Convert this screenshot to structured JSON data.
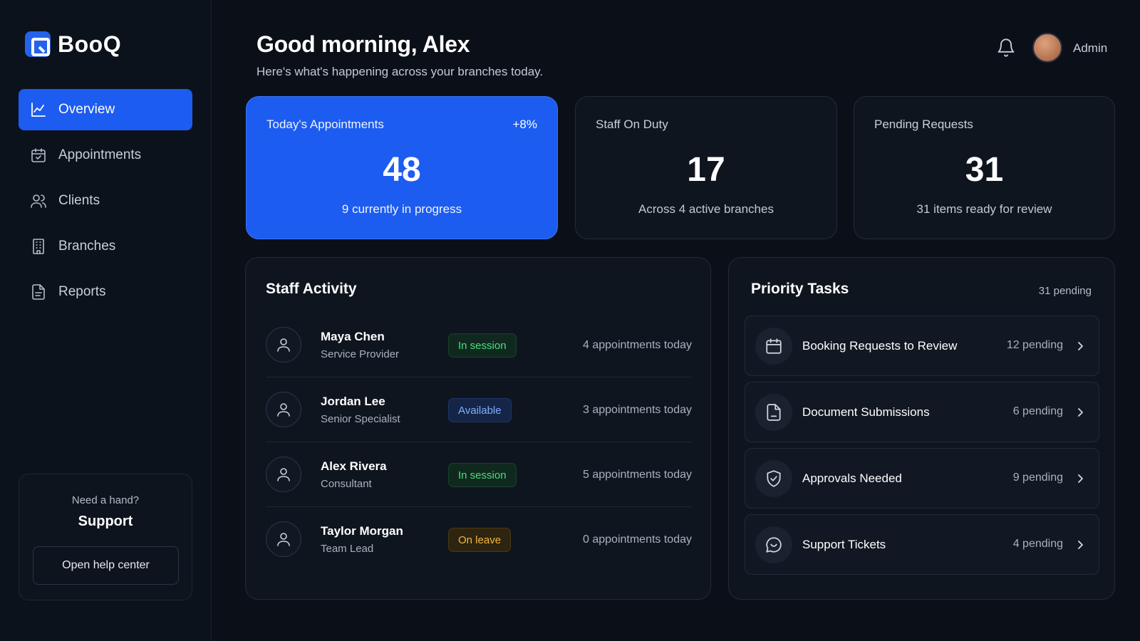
{
  "app": {
    "name": "BooQ"
  },
  "sidebar": {
    "items": [
      {
        "label": "Overview",
        "icon": "chart-line-icon",
        "active": true
      },
      {
        "label": "Appointments",
        "icon": "calendar-check-icon",
        "active": false
      },
      {
        "label": "Clients",
        "icon": "users-icon",
        "active": false
      },
      {
        "label": "Branches",
        "icon": "building-icon",
        "active": false
      },
      {
        "label": "Reports",
        "icon": "document-icon",
        "active": false
      }
    ],
    "support": {
      "question": "Need a hand?",
      "title": "Support",
      "button": "Open help center"
    }
  },
  "header": {
    "greeting": "Good morning, Alex",
    "subtitle": "Here's what's happening across your branches today.",
    "user_label": "Admin"
  },
  "stats": [
    {
      "label": "Today's Appointments",
      "delta": "+8%",
      "value": "48",
      "note": "9 currently in progress"
    },
    {
      "label": "Staff On Duty",
      "value": "17",
      "note": "Across 4 active branches"
    },
    {
      "label": "Pending Requests",
      "value": "31",
      "note": "31 items ready for review"
    }
  ],
  "staff_activity": {
    "title": "Staff Activity",
    "rows": [
      {
        "name": "Maya Chen",
        "role": "Service Provider",
        "status": "In session",
        "appointments": "4 appointments today"
      },
      {
        "name": "Jordan Lee",
        "role": "Senior Specialist",
        "status": "Available",
        "appointments": "3 appointments today"
      },
      {
        "name": "Alex Rivera",
        "role": "Consultant",
        "status": "In session",
        "appointments": "5 appointments today"
      },
      {
        "name": "Taylor Morgan",
        "role": "Team Lead",
        "status": "On leave",
        "appointments": "0 appointments today"
      }
    ]
  },
  "priority_tasks": {
    "title": "Priority Tasks",
    "count": "31 pending",
    "rows": [
      {
        "label": "Booking Requests to Review",
        "pending": "12 pending",
        "icon": "calendar-icon"
      },
      {
        "label": "Document Submissions",
        "pending": "6 pending",
        "icon": "document-icon"
      },
      {
        "label": "Approvals Needed",
        "pending": "9 pending",
        "icon": "shield-check-icon"
      },
      {
        "label": "Support Tickets",
        "pending": "4 pending",
        "icon": "chat-bubble-icon"
      }
    ]
  },
  "colors": {
    "accent": "#1d5cf0",
    "background": "#0b1018",
    "status_in_session": "#4ade80",
    "status_available": "#7fb0ff",
    "status_on_leave": "#f5b83d"
  }
}
